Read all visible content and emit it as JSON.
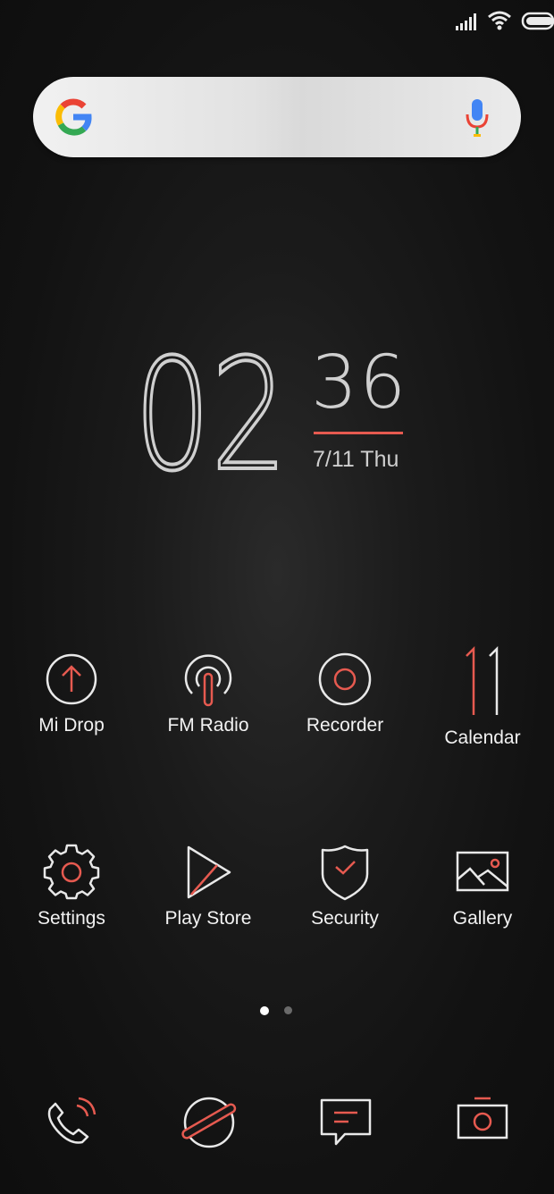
{
  "status_bar": {
    "icons": [
      "signal-icon",
      "wifi-icon",
      "battery-icon"
    ]
  },
  "search": {
    "icons": [
      "google-g-icon",
      "microphone-icon"
    ]
  },
  "clock": {
    "hours": "02",
    "minutes": "36",
    "date": "7/11 Thu"
  },
  "apps": {
    "row1": [
      {
        "label": "Mi Drop",
        "icon": "mi-drop-icon"
      },
      {
        "label": "FM Radio",
        "icon": "fm-radio-icon"
      },
      {
        "label": "Recorder",
        "icon": "recorder-icon"
      },
      {
        "label": "Calendar",
        "icon": "calendar-icon",
        "icon_text": "11"
      }
    ],
    "row2": [
      {
        "label": "Settings",
        "icon": "settings-gear-icon"
      },
      {
        "label": "Play Store",
        "icon": "play-store-icon"
      },
      {
        "label": "Security",
        "icon": "security-shield-icon"
      },
      {
        "label": "Gallery",
        "icon": "gallery-icon"
      }
    ]
  },
  "page_indicator": {
    "pages": 2,
    "active_page": 1
  },
  "dock": [
    "phone-icon",
    "browser-icon",
    "messages-icon",
    "camera-icon"
  ],
  "colors": {
    "accent": "#e65a50",
    "icon_stroke": "#e8e8e8",
    "text": "#f2f2f2"
  }
}
